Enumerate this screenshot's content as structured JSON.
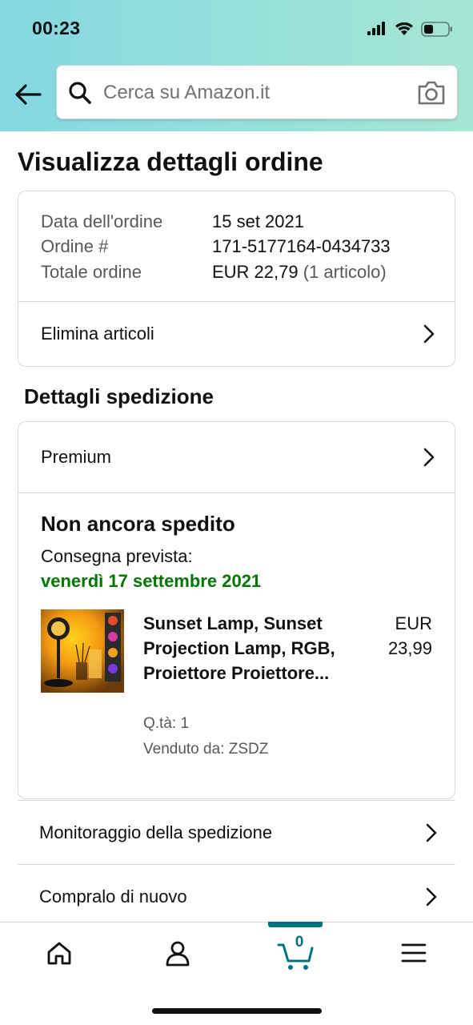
{
  "status_bar": {
    "time": "00:23"
  },
  "header": {
    "back_icon": "arrow-left-icon",
    "search": {
      "placeholder": "Cerca su Amazon.it",
      "value": ""
    }
  },
  "page": {
    "title": "Visualizza dettagli ordine"
  },
  "order_summary": {
    "rows": [
      {
        "label": "Data dell'ordine",
        "value": "15 set 2021"
      },
      {
        "label": "Ordine #",
        "value": "171-5177164-0434733"
      },
      {
        "label": "Totale ordine",
        "value": "EUR 22,79",
        "extra": "(1 articolo)"
      }
    ],
    "remove_items_label": "Elimina articoli"
  },
  "shipping": {
    "section_title": "Dettagli spedizione",
    "plan_label": "Premium",
    "status": "Non ancora spedito",
    "delivery_label": "Consegna prevista:",
    "delivery_date": "venerdì 17 settembre 2021",
    "item": {
      "title": "Sunset Lamp, Sunset Projection Lamp, RGB, Proiettore Proiettore...",
      "price_currency": "EUR",
      "price_value": "23,99",
      "quantity": "Q.tà: 1",
      "seller": "Venduto da: ZSDZ"
    }
  },
  "actions": [
    {
      "label": "Monitoraggio della spedizione"
    },
    {
      "label": "Compralo di nuovo"
    }
  ],
  "tab_bar": {
    "tabs": [
      "home-icon",
      "account-icon",
      "cart-icon",
      "menu-icon"
    ],
    "active": "cart-icon",
    "cart_count": "0"
  },
  "colors": {
    "header_gradient_start": "#84d8e2",
    "header_gradient_end": "#a6e6d4",
    "delivery_green": "#007600",
    "accent_teal": "#007185",
    "border": "#d5d9d9"
  }
}
